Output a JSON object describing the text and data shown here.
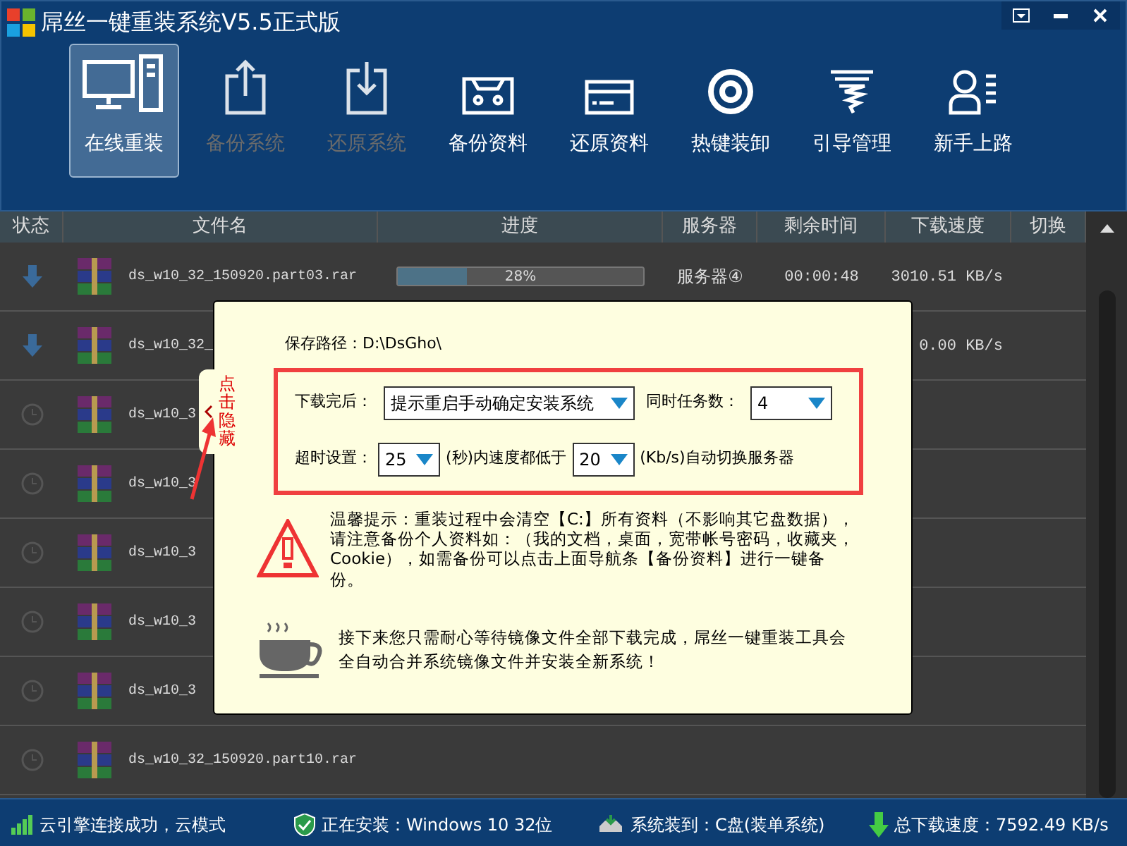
{
  "window": {
    "title": "屌丝一键重装系统V5.5正式版"
  },
  "toolbar": [
    {
      "label": "在线重装",
      "kind": "pc",
      "selected": true,
      "disabled": false
    },
    {
      "label": "备份系统",
      "kind": "upload",
      "selected": false,
      "disabled": true
    },
    {
      "label": "还原系统",
      "kind": "download",
      "selected": false,
      "disabled": true
    },
    {
      "label": "备份资料",
      "kind": "tape",
      "selected": false,
      "disabled": false
    },
    {
      "label": "还原资料",
      "kind": "card",
      "selected": false,
      "disabled": false
    },
    {
      "label": "热键装卸",
      "kind": "ring",
      "selected": false,
      "disabled": false
    },
    {
      "label": "引导管理",
      "kind": "tornado",
      "selected": false,
      "disabled": false
    },
    {
      "label": "新手上路",
      "kind": "user",
      "selected": false,
      "disabled": false
    }
  ],
  "table": {
    "columns": [
      "状态",
      "文件名",
      "进度",
      "服务器",
      "剩余时间",
      "下载速度",
      "切换"
    ],
    "rows": [
      {
        "kind": "downloading",
        "file": "ds_w10_32_150920.part03.rar",
        "level": 0.28,
        "progress": "28%",
        "server": "服务器④",
        "remaining": "00:00:48",
        "speed": "3010.51 KB/s"
      },
      {
        "kind": "downloading",
        "file": "ds_w10_32_",
        "speed": "0.00 KB/s"
      },
      {
        "kind": "waiting",
        "file": "ds_w10_3"
      },
      {
        "kind": "waiting",
        "file": "ds_w10_3"
      },
      {
        "kind": "waiting",
        "file": "ds_w10_3"
      },
      {
        "kind": "waiting",
        "file": "ds_w10_3"
      },
      {
        "kind": "waiting",
        "file": "ds_w10_3"
      },
      {
        "kind": "waiting",
        "file": "ds_w10_32_150920.part10.rar"
      }
    ]
  },
  "side_tab": {
    "label": "点击隐藏"
  },
  "dialog": {
    "save_path": "保存路径：D:\\DsGho\\",
    "after_download_label": "下载完后：",
    "after_download": "提示重启手动确定安装系统",
    "tasks_label": "同时任务数：",
    "tasks": "4",
    "timeout_label": "超时设置：",
    "timeout": "25",
    "seconds_label": "(秒)内速度都低于",
    "speed_limit": "20",
    "switch_label": "(Kb/s)自动切换服务器",
    "warning": "温馨提示：重装过程中会清空【C:】所有资料（不影响其它盘数据），请注意备份个人资料如：（我的文档，桌面，宽带帐号密码，收藏夹，Cookie），如需备份可以点击上面导航条【备份资料】进行一键备份。",
    "info": "接下来您只需耐心等待镜像文件全部下载完成，屌丝一键重装工具会全自动合并系统镜像文件并安装全新系统！"
  },
  "status_bar": [
    "云引擎连接成功，云模式",
    "正在安装：Windows 10 32位",
    "系统装到：C盘(装单系统)",
    "总下载速度：7592.49 KB/s"
  ]
}
